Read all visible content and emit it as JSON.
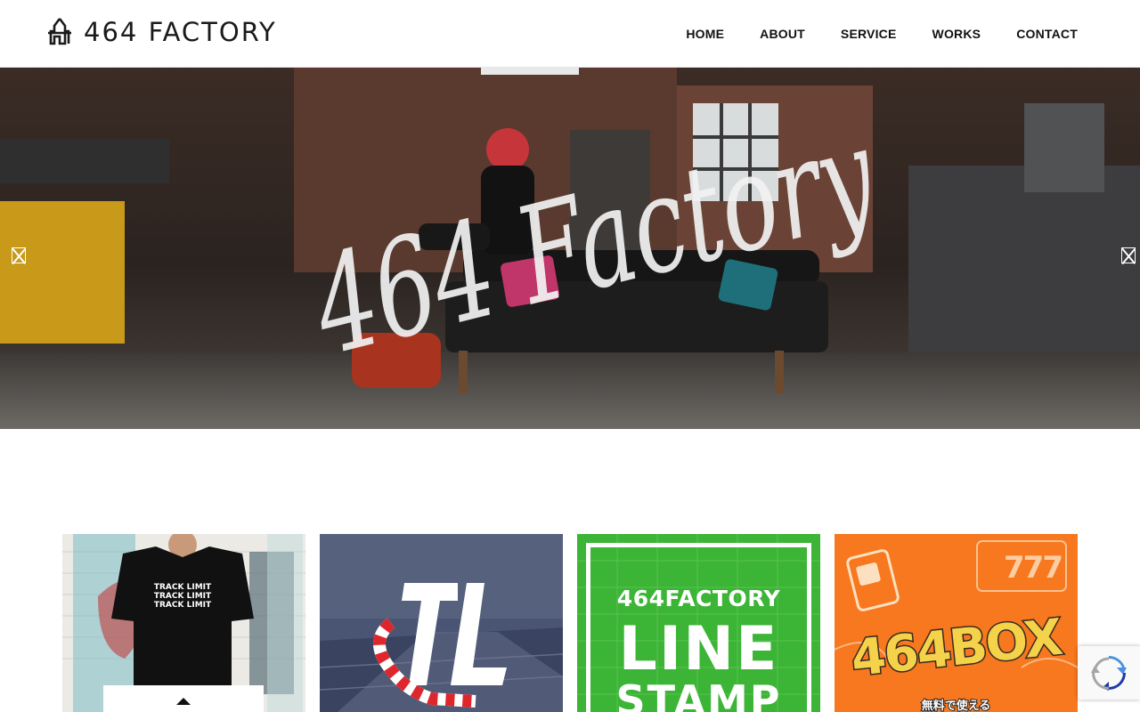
{
  "header": {
    "logo_text": "464 FACTORY",
    "nav": [
      "HOME",
      "ABOUT",
      "SERVICE",
      "WORKS",
      "CONTACT"
    ]
  },
  "hero": {
    "overlay_text": "464 Factory",
    "prev_icon": "slider-prev-icon",
    "next_icon": "slider-next-icon"
  },
  "cards": {
    "card1": {
      "shirt_text": "TRACK LIMIT"
    },
    "card2": {
      "logo_text": "TL"
    },
    "card3": {
      "line1": "464FACTORY",
      "line2": "LINE",
      "line3": "STAMP"
    },
    "card4": {
      "title": "464BOX",
      "subtitle": "無料で使える",
      "slot": "777"
    }
  },
  "recaptcha": {
    "icon": "recaptcha-icon"
  },
  "colors": {
    "nav_text": "#111111",
    "line_green": "#3cb436",
    "box_orange": "#f7781e",
    "tl_blue": "#3e4a68",
    "tl_red": "#e0262d"
  }
}
